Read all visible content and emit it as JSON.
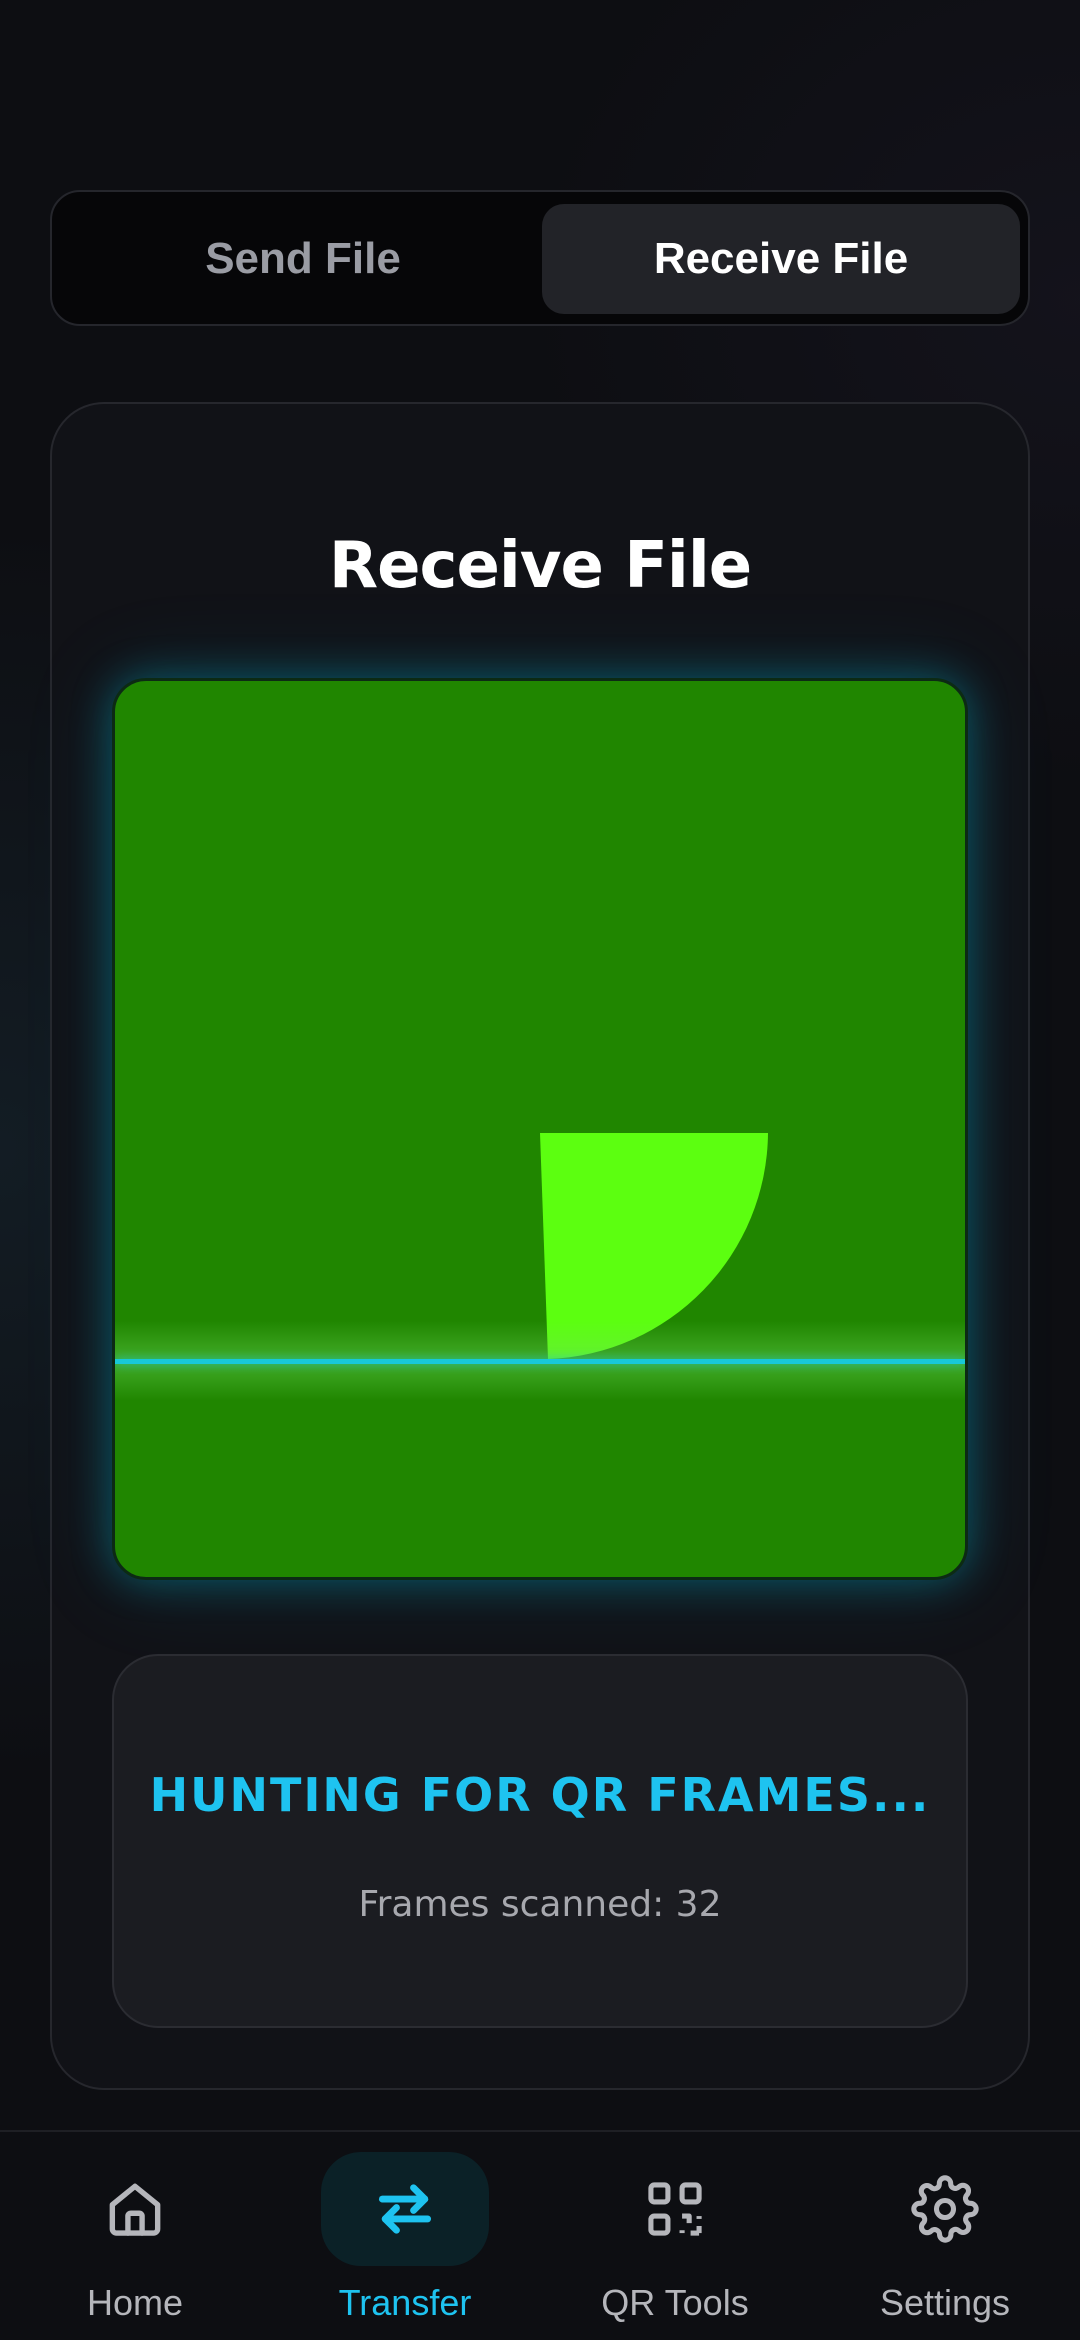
{
  "tabs": {
    "send_label": "Send File",
    "receive_label": "Receive File",
    "selected": "receive"
  },
  "card": {
    "title": "Receive File"
  },
  "scanner": {
    "status_heading": "HUNTING FOR QR FRAMES...",
    "frames_text": "Frames scanned: 32"
  },
  "nav": {
    "items": [
      {
        "label": "Home",
        "icon": "home-icon",
        "active": false
      },
      {
        "label": "Transfer",
        "icon": "transfer-arrows-icon",
        "active": true
      },
      {
        "label": "QR Tools",
        "icon": "qr-code-icon",
        "active": false
      },
      {
        "label": "Settings",
        "icon": "gear-icon",
        "active": false
      }
    ]
  },
  "colors": {
    "accent": "#1ec3f0",
    "camera_bg": "#208600",
    "wedge": "#5cff10",
    "scan_line": "#18c8d8",
    "background": "#0d0e12"
  }
}
